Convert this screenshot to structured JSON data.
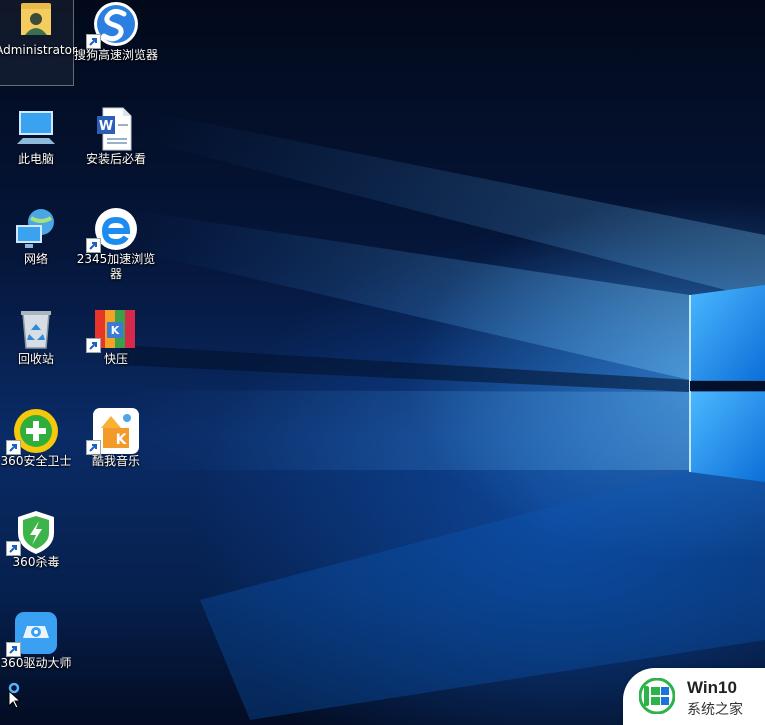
{
  "desktop": {
    "icons": [
      {
        "label": "Administrator",
        "icon": "user-folder-icon"
      },
      {
        "label": "搜狗高速浏览器",
        "icon": "sogou-browser-icon"
      },
      {
        "label": "此电脑",
        "icon": "computer-icon"
      },
      {
        "label": "安装后必看",
        "icon": "word-document-icon"
      },
      {
        "label": "网络",
        "icon": "network-icon"
      },
      {
        "label": "2345加速浏览器",
        "icon": "2345-browser-icon"
      },
      {
        "label": "回收站",
        "icon": "recycle-bin-icon"
      },
      {
        "label": "快压",
        "icon": "kuaiya-icon"
      },
      {
        "label": "360安全卫士",
        "icon": "360-safe-icon"
      },
      {
        "label": "酷我音乐",
        "icon": "kuwo-music-icon"
      },
      {
        "label": "360杀毒",
        "icon": "360-antivirus-icon"
      },
      {
        "label": "360驱动大师",
        "icon": "360-driver-icon"
      }
    ]
  },
  "watermark": {
    "title": "Win10",
    "subtitle": "系统之家",
    "colors": {
      "green": "#2cb34a",
      "blue": "#1e73d8"
    }
  },
  "colors": {
    "wallpaper_blue": "#1a72d8",
    "window_light": "#7fd0ff"
  }
}
